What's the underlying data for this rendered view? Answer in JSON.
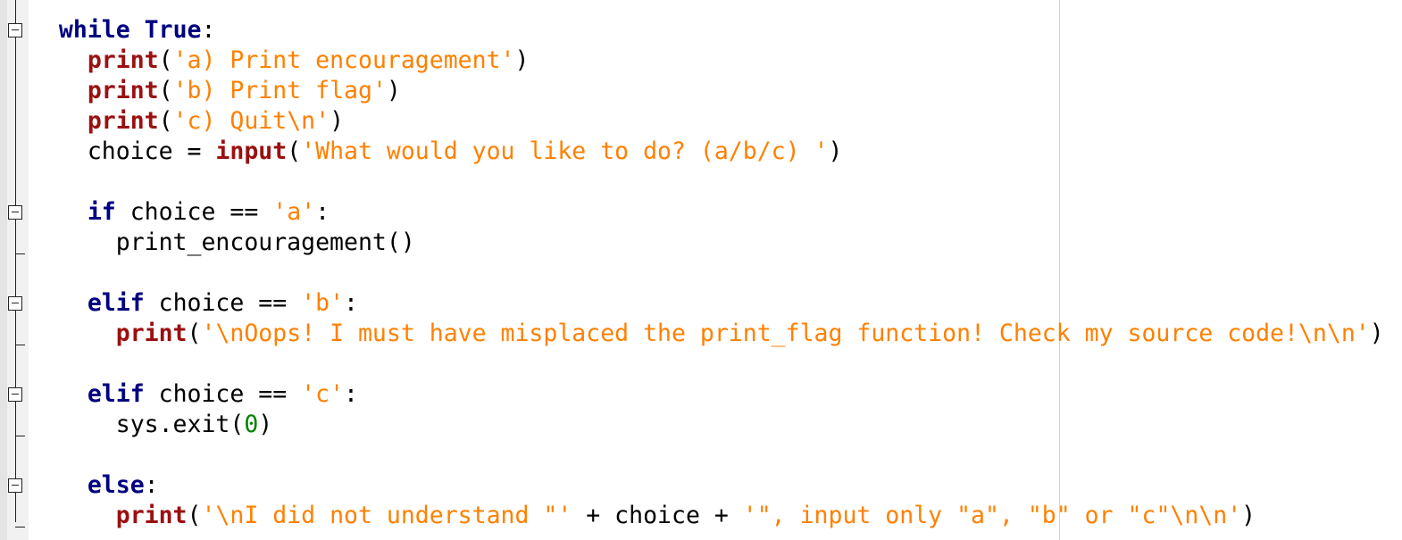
{
  "editor": {
    "language": "python",
    "colors": {
      "keyword": "#000080",
      "builtin": "#9b1010",
      "string": "#ff8000",
      "number": "#008000",
      "text": "#000000",
      "edge": "#b7e4b0"
    },
    "lines": [
      {
        "indent": 1,
        "tokens": [
          {
            "t": "kw",
            "v": "while"
          },
          {
            "t": "pl",
            "v": " "
          },
          {
            "t": "kw",
            "v": "True"
          },
          {
            "t": "pl",
            "v": ":"
          }
        ]
      },
      {
        "indent": 2,
        "tokens": [
          {
            "t": "bi",
            "v": "print"
          },
          {
            "t": "pl",
            "v": "("
          },
          {
            "t": "str",
            "v": "'a) Print encouragement'"
          },
          {
            "t": "pl",
            "v": ")"
          }
        ]
      },
      {
        "indent": 2,
        "tokens": [
          {
            "t": "bi",
            "v": "print"
          },
          {
            "t": "pl",
            "v": "("
          },
          {
            "t": "str",
            "v": "'b) Print flag'"
          },
          {
            "t": "pl",
            "v": ")"
          }
        ]
      },
      {
        "indent": 2,
        "tokens": [
          {
            "t": "bi",
            "v": "print"
          },
          {
            "t": "pl",
            "v": "("
          },
          {
            "t": "str",
            "v": "'c) Quit\\n'"
          },
          {
            "t": "pl",
            "v": ")"
          }
        ]
      },
      {
        "indent": 2,
        "tokens": [
          {
            "t": "pl",
            "v": "choice = "
          },
          {
            "t": "bi",
            "v": "input"
          },
          {
            "t": "pl",
            "v": "("
          },
          {
            "t": "str",
            "v": "'What would you like to do? (a/b/c) '"
          },
          {
            "t": "pl",
            "v": ")"
          }
        ]
      },
      {
        "indent": 0,
        "tokens": []
      },
      {
        "indent": 2,
        "tokens": [
          {
            "t": "kw",
            "v": "if"
          },
          {
            "t": "pl",
            "v": " choice == "
          },
          {
            "t": "str",
            "v": "'a'"
          },
          {
            "t": "pl",
            "v": ":"
          }
        ]
      },
      {
        "indent": 3,
        "tokens": [
          {
            "t": "pl",
            "v": "print_encouragement()"
          }
        ]
      },
      {
        "indent": 0,
        "tokens": []
      },
      {
        "indent": 2,
        "tokens": [
          {
            "t": "kw",
            "v": "elif"
          },
          {
            "t": "pl",
            "v": " choice == "
          },
          {
            "t": "str",
            "v": "'b'"
          },
          {
            "t": "pl",
            "v": ":"
          }
        ]
      },
      {
        "indent": 3,
        "tokens": [
          {
            "t": "bi",
            "v": "print"
          },
          {
            "t": "pl",
            "v": "("
          },
          {
            "t": "str",
            "v": "'\\nOops! I must have misplaced the print_flag function! Check my source code!\\n\\n'"
          },
          {
            "t": "pl",
            "v": ")"
          }
        ]
      },
      {
        "indent": 0,
        "tokens": []
      },
      {
        "indent": 2,
        "tokens": [
          {
            "t": "kw",
            "v": "elif"
          },
          {
            "t": "pl",
            "v": " choice == "
          },
          {
            "t": "str",
            "v": "'c'"
          },
          {
            "t": "pl",
            "v": ":"
          }
        ]
      },
      {
        "indent": 3,
        "tokens": [
          {
            "t": "pl",
            "v": "sys.exit("
          },
          {
            "t": "num",
            "v": "0"
          },
          {
            "t": "pl",
            "v": ")"
          }
        ]
      },
      {
        "indent": 0,
        "tokens": []
      },
      {
        "indent": 2,
        "tokens": [
          {
            "t": "kw",
            "v": "else"
          },
          {
            "t": "pl",
            "v": ":"
          }
        ]
      },
      {
        "indent": 3,
        "tokens": [
          {
            "t": "bi",
            "v": "print"
          },
          {
            "t": "pl",
            "v": "("
          },
          {
            "t": "str",
            "v": "'\\nI did not understand \"'"
          },
          {
            "t": "pl",
            "v": " + choice + "
          },
          {
            "t": "str",
            "v": "'\", input only \"a\", \"b\" or \"c\"\\n\\n'"
          },
          {
            "t": "pl",
            "v": ")"
          }
        ]
      }
    ],
    "fold_markers": [
      {
        "line": 0,
        "type": "box"
      },
      {
        "line": 6,
        "type": "box"
      },
      {
        "line": 7,
        "type": "end"
      },
      {
        "line": 9,
        "type": "box"
      },
      {
        "line": 10,
        "type": "end"
      },
      {
        "line": 12,
        "type": "box"
      },
      {
        "line": 13,
        "type": "end"
      },
      {
        "line": 15,
        "type": "box"
      },
      {
        "line": 16,
        "type": "end"
      }
    ]
  }
}
